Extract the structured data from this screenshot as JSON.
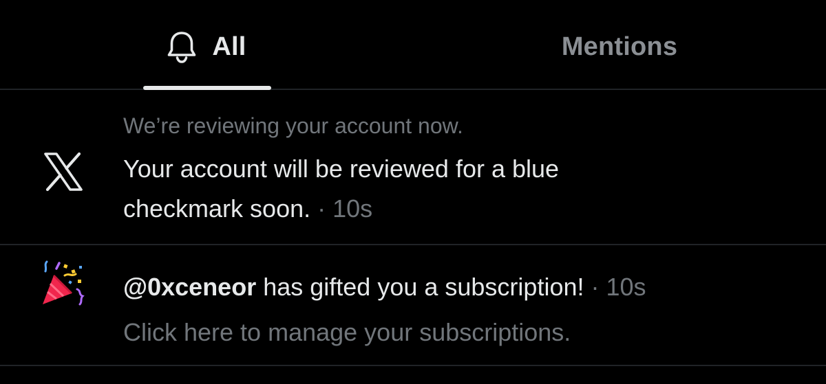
{
  "tabs": [
    {
      "label": "All",
      "icon": "bell-icon",
      "active": true
    },
    {
      "label": "Mentions",
      "active": false
    }
  ],
  "notifications": [
    {
      "avatar_icon": "x-logo-icon",
      "subheading": "We’re reviewing your account now.",
      "text_line1": "Your account will be reviewed for a blue",
      "text_line2": "checkmark soon.",
      "separator": " · ",
      "time": "10s"
    },
    {
      "avatar_icon": "party-popper-icon",
      "handle": "@0xceneor",
      "message": " has gifted you a subscription!",
      "separator": " · ",
      "time": "10s",
      "link_text": "Click here to manage your subscriptions."
    }
  ],
  "colors": {
    "background": "#000000",
    "text_primary": "#e7e9ea",
    "text_secondary": "#71767b",
    "divider": "#202327"
  }
}
